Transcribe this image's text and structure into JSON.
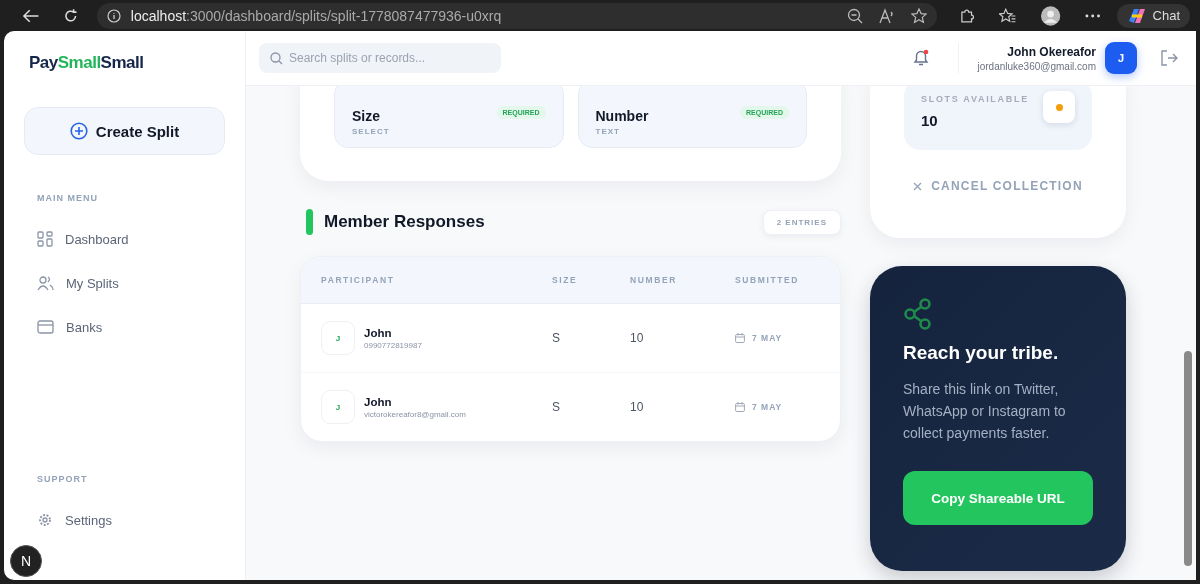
{
  "browser": {
    "url_host": "localhost",
    "url_path": ":3000/dashboard/splits/split-1778087477936-u0xrq",
    "chat_label": "Chat"
  },
  "sidebar": {
    "logo": [
      {
        "text": "Pay",
        "color": "#16254a"
      },
      {
        "text": "Small",
        "color": "#22b55a"
      },
      {
        "text": "Small",
        "color": "#16254a"
      }
    ],
    "create_button": "Create Split",
    "sections": [
      {
        "title": "MAIN MENU",
        "items": [
          {
            "label": "Dashboard",
            "kind": "grid",
            "selected": false
          },
          {
            "label": "My Splits",
            "kind": "users",
            "selected": false
          },
          {
            "label": "Banks",
            "kind": "card",
            "selected": false
          }
        ]
      },
      {
        "title": "SUPPORT",
        "items": [
          {
            "label": "Settings",
            "kind": "gear",
            "selected": false
          }
        ]
      }
    ],
    "dev_badge": "N"
  },
  "header": {
    "search_placeholder": "Search splits or records...",
    "notification_unread": true,
    "user": {
      "name": "John Okereafor",
      "email": "jordanluke360@gmail.com",
      "initial": "J"
    }
  },
  "form_fields": [
    {
      "label": "Size",
      "type": "SELECT",
      "badge": "REQUIRED"
    },
    {
      "label": "Number",
      "type": "TEXT",
      "badge": "REQUIRED"
    }
  ],
  "slots": {
    "label": "SLOTS AVAILABLE",
    "value": "10"
  },
  "cancel_label": "CANCEL COLLECTION",
  "responses": {
    "title": "Member Responses",
    "count": "2 ENTRIES",
    "columns": [
      "PARTICIPANT",
      "SIZE",
      "NUMBER",
      "SUBMITTED"
    ],
    "rows": [
      {
        "initial": "J",
        "name": "John",
        "contact": "0990772819987",
        "size": "S",
        "number": "10",
        "submitted": "7 MAY"
      },
      {
        "initial": "J",
        "name": "John",
        "contact": "victorokereafor8@gmail.com",
        "size": "S",
        "number": "10",
        "submitted": "7 MAY"
      }
    ]
  },
  "share": {
    "title": "Reach your tribe.",
    "text": "Share this link on Twitter, WhatsApp or Instagram to collect payments faster.",
    "button": "Copy Shareable URL"
  }
}
